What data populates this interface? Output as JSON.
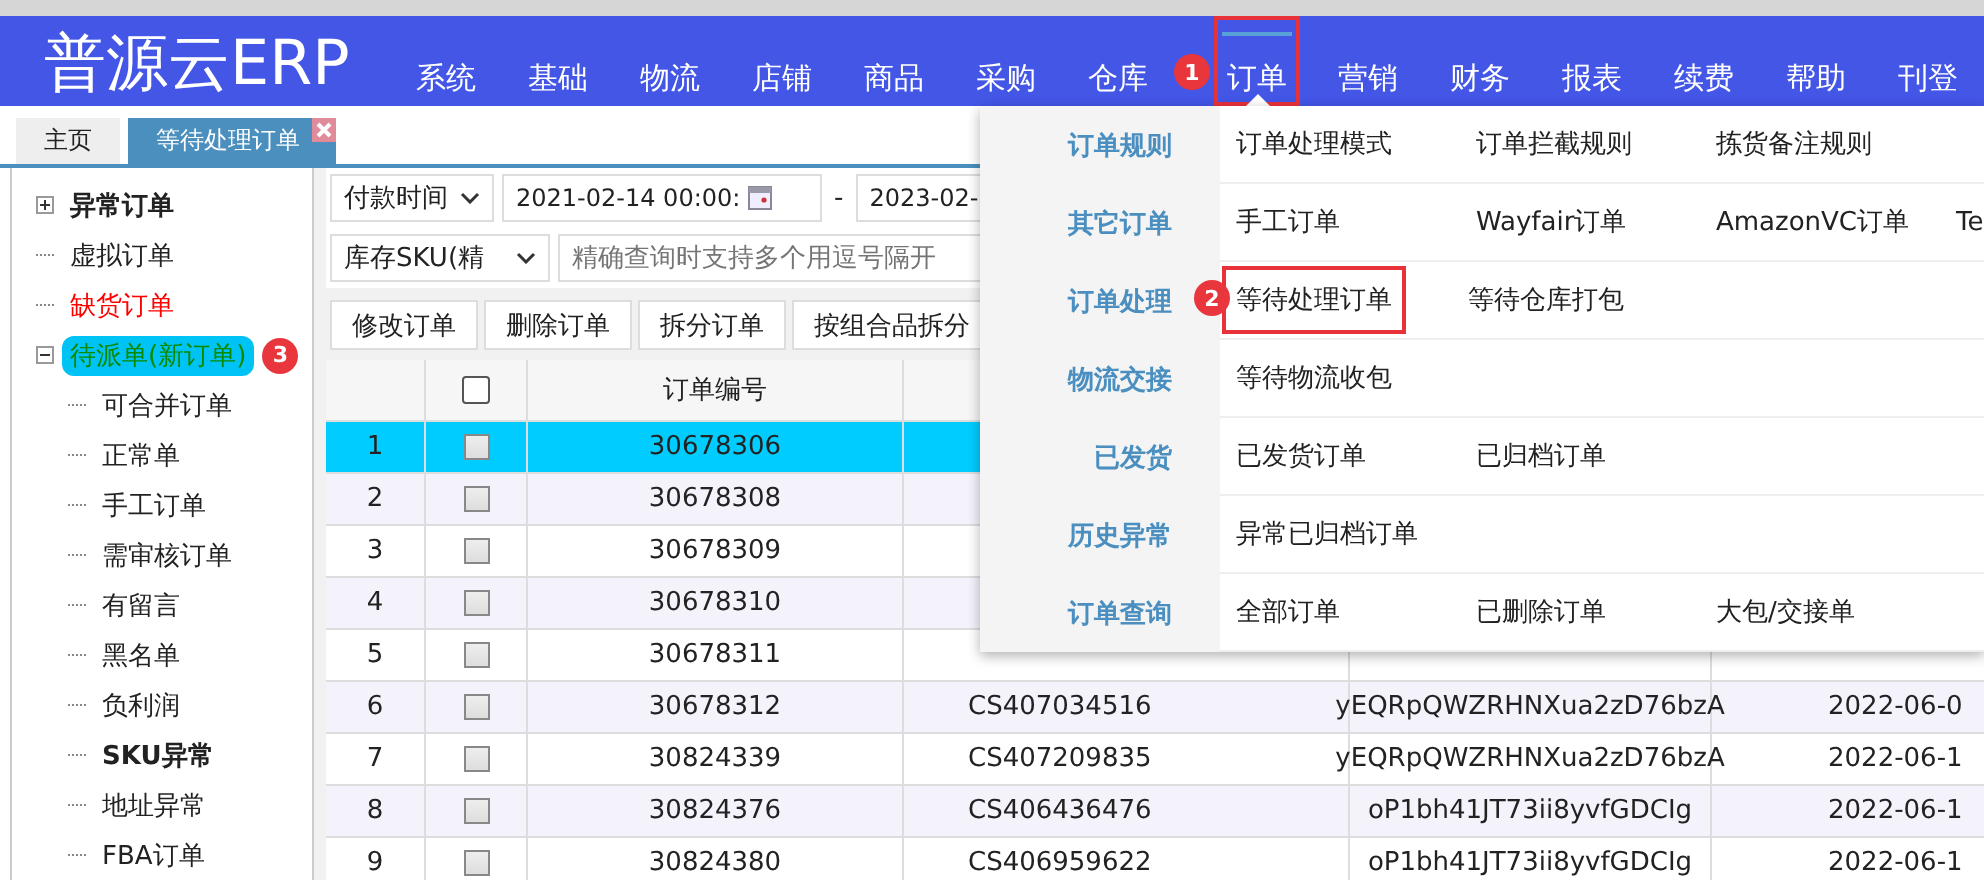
{
  "header": {
    "logo": "普源云ERP",
    "nav": [
      {
        "label": "系统",
        "selected": false
      },
      {
        "label": "基础",
        "selected": false
      },
      {
        "label": "物流",
        "selected": false
      },
      {
        "label": "店铺",
        "selected": false
      },
      {
        "label": "商品",
        "selected": false
      },
      {
        "label": "采购",
        "selected": false
      },
      {
        "label": "仓库",
        "selected": false
      },
      {
        "label": "订单",
        "selected": true,
        "highlight": true,
        "callout": "1"
      },
      {
        "label": "营销",
        "selected": false
      },
      {
        "label": "财务",
        "selected": false
      },
      {
        "label": "报表",
        "selected": false
      },
      {
        "label": "续费",
        "selected": false
      },
      {
        "label": "帮助",
        "selected": false
      },
      {
        "label": "刊登",
        "selected": false
      }
    ]
  },
  "tabs": [
    {
      "label": "主页",
      "selected": false
    },
    {
      "label": "等待处理订单",
      "selected": true,
      "closable": true
    }
  ],
  "sidebar": {
    "tree": [
      {
        "label": "异常订单",
        "kind": "bold",
        "expanded": false,
        "selected": false
      },
      {
        "label": "虚拟订单",
        "kind": "plain",
        "selected": false
      },
      {
        "label": "缺货订单",
        "kind": "warning",
        "selected": false
      },
      {
        "label": "待派单(新订单)",
        "kind": "plain",
        "expanded": true,
        "selected": true,
        "callout": "3",
        "children": [
          {
            "label": "可合并订单",
            "kind": "plain",
            "selected": false
          },
          {
            "label": "正常单",
            "kind": "plain",
            "selected": false
          },
          {
            "label": "手工订单",
            "kind": "plain",
            "selected": false
          },
          {
            "label": "需审核订单",
            "kind": "plain",
            "selected": false
          },
          {
            "label": "有留言",
            "kind": "plain",
            "selected": false
          },
          {
            "label": "黑名单",
            "kind": "plain",
            "selected": false
          },
          {
            "label": "负利润",
            "kind": "plain",
            "selected": false
          },
          {
            "label": "SKU异常",
            "kind": "bold",
            "selected": false
          },
          {
            "label": "地址异常",
            "kind": "plain",
            "selected": false
          },
          {
            "label": "FBA订单",
            "kind": "plain",
            "selected": false
          }
        ]
      }
    ]
  },
  "filters": {
    "time_field": "付款时间",
    "date_from": "2021-02-14 00:00:",
    "separator": "-",
    "date_to": "2023-02-",
    "search_field": "库存SKU(精",
    "search_placeholder": "精确查询时支持多个用逗号隔开"
  },
  "toolbar": [
    "修改订单",
    "删除订单",
    "拆分订单",
    "按组合品拆分"
  ],
  "table": {
    "header": "订单编号",
    "select_all": {
      "checked": false
    },
    "rows": [
      {
        "index": "1",
        "selected": true,
        "checked": false,
        "order_no": "30678306"
      },
      {
        "index": "2",
        "selected": false,
        "checked": false,
        "order_no": "30678308"
      },
      {
        "index": "3",
        "selected": false,
        "checked": false,
        "order_no": "30678309"
      },
      {
        "index": "4",
        "selected": false,
        "checked": false,
        "order_no": "30678310"
      },
      {
        "index": "5",
        "selected": false,
        "checked": false,
        "order_no": "30678311"
      },
      {
        "index": "6",
        "selected": false,
        "checked": false,
        "order_no": "30678312",
        "column_4": "CS407034516",
        "column_5": "yEQRpQWZRHNXua2zD76bzA",
        "column_6": "2022-06-0"
      },
      {
        "index": "7",
        "selected": false,
        "checked": false,
        "order_no": "30824339",
        "column_4": "CS407209835",
        "column_5": "yEQRpQWZRHNXua2zD76bzA",
        "column_6": "2022-06-1"
      },
      {
        "index": "8",
        "selected": false,
        "checked": false,
        "order_no": "30824376",
        "column_4": "CS406436476",
        "column_5": "oP1bh41JT73ii8yvfGDCIg",
        "column_6": "2022-06-1"
      },
      {
        "index": "9",
        "selected": false,
        "checked": false,
        "order_no": "30824380",
        "column_4": "CS406959622",
        "column_5": "oP1bh41JT73ii8yvfGDCIg",
        "column_6": "2022-06-1"
      }
    ]
  },
  "menu": {
    "groups": [
      {
        "label": "订单规则",
        "items": [
          {
            "label": "订单处理模式",
            "highlight": false
          },
          {
            "label": "订单拦截规则",
            "highlight": false
          },
          {
            "label": "拣货备注规则",
            "highlight": false
          }
        ]
      },
      {
        "label": "其它订单",
        "items": [
          {
            "label": "手工订单",
            "highlight": false
          },
          {
            "label": "Wayfair订单",
            "highlight": false
          },
          {
            "label": "AmazonVC订单",
            "highlight": false
          },
          {
            "label": "Te",
            "highlight": false
          }
        ]
      },
      {
        "label": "订单处理",
        "items": [
          {
            "label": "等待处理订单",
            "highlight": true,
            "callout": "2"
          },
          {
            "label": "等待仓库打包",
            "highlight": false
          }
        ]
      },
      {
        "label": "物流交接",
        "items": [
          {
            "label": "等待物流收包",
            "highlight": false
          }
        ]
      },
      {
        "label": "已发货",
        "items": [
          {
            "label": "已发货订单",
            "highlight": false
          },
          {
            "label": "已归档订单",
            "highlight": false
          }
        ]
      },
      {
        "label": "历史异常",
        "items": [
          {
            "label": "异常已归档订单",
            "highlight": false
          }
        ]
      },
      {
        "label": "订单查询",
        "items": [
          {
            "label": "全部订单",
            "highlight": false
          },
          {
            "label": "已删除订单",
            "highlight": false
          },
          {
            "label": "大包/交接单",
            "highlight": false
          }
        ]
      }
    ]
  }
}
